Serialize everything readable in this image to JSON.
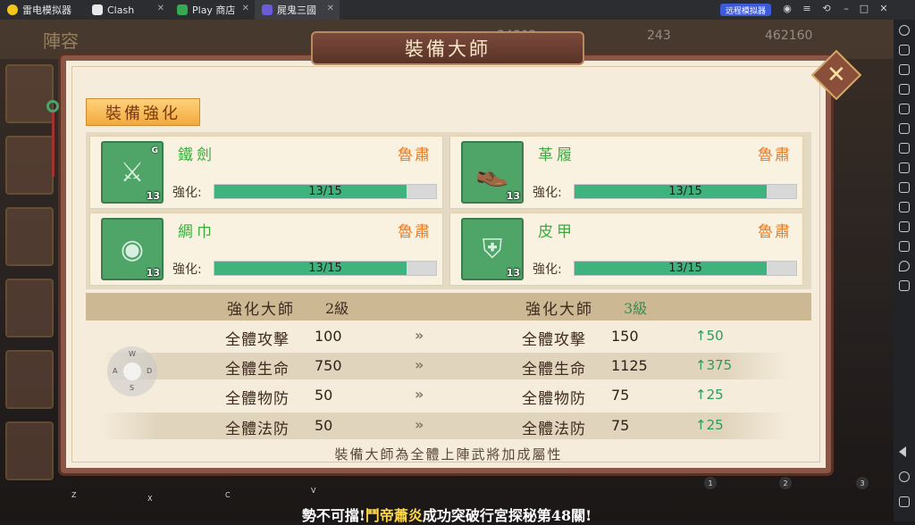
{
  "emulator": {
    "tabs": [
      {
        "label": "雷电模拟器",
        "color": "#f5c518"
      },
      {
        "label": "Clash",
        "color": "#e8e8e8"
      },
      {
        "label": "Play 商店",
        "color": "#34a853"
      },
      {
        "label": "屍鬼三國",
        "color": "#6b5bd6"
      }
    ],
    "remote_button": "远程模拟器"
  },
  "game": {
    "background_title": "陣容",
    "background_resources": [
      "34802",
      "243",
      "462160"
    ],
    "panel": {
      "title": "裝備大師",
      "section_tag": "裝備強化",
      "equipment": [
        {
          "name": "鐵劍",
          "owner": "魯肅",
          "level": "13",
          "grade": "G",
          "strengthen_label": "強化:",
          "progress_text": "13/15",
          "progress": 0.867,
          "icon": "sword-icon",
          "glyph": "⚔"
        },
        {
          "name": "革履",
          "owner": "魯肅",
          "level": "13",
          "grade": "",
          "strengthen_label": "強化:",
          "progress_text": "13/15",
          "progress": 0.867,
          "icon": "boots-icon",
          "glyph": "👞"
        },
        {
          "name": "綢巾",
          "owner": "魯肅",
          "level": "13",
          "grade": "",
          "strengthen_label": "強化:",
          "progress_text": "13/15",
          "progress": 0.867,
          "icon": "headband-icon",
          "glyph": "◉"
        },
        {
          "name": "皮甲",
          "owner": "魯肅",
          "level": "13",
          "grade": "",
          "strengthen_label": "強化:",
          "progress_text": "13/15",
          "progress": 0.867,
          "icon": "armor-icon",
          "glyph": "⛨"
        }
      ],
      "master": {
        "label": "強化大師",
        "current_level": "2級",
        "next_level": "3級"
      },
      "stats": [
        {
          "name": "全體攻擊",
          "current": "100",
          "next": "150",
          "gain": "50"
        },
        {
          "name": "全體生命",
          "current": "750",
          "next": "1125",
          "gain": "375"
        },
        {
          "name": "全體物防",
          "current": "50",
          "next": "75",
          "gain": "25"
        },
        {
          "name": "全體法防",
          "current": "50",
          "next": "75",
          "gain": "25"
        }
      ],
      "arrow": "»",
      "footer": "裝備大師為全體上陣武將加成屬性"
    }
  },
  "overlay": {
    "joystick_keys": {
      "up": "W",
      "left": "A",
      "right": "D",
      "down": "S"
    },
    "key_hints": [
      "Z",
      "X",
      "C",
      "V"
    ],
    "number_hints": [
      "1",
      "2",
      "3"
    ],
    "marquee": {
      "prefix": "勢不可擋!",
      "name": "鬥帝蕭炎",
      "suffix": "成功突破行宮探秘第48關!"
    }
  }
}
